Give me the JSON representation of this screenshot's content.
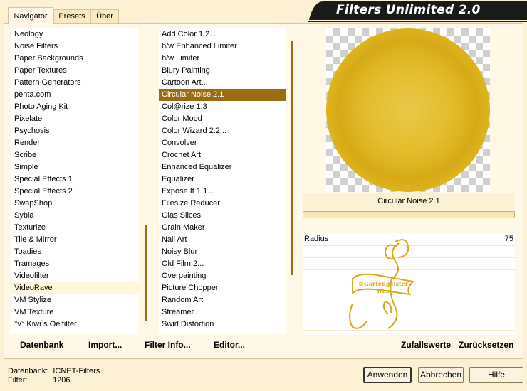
{
  "tabs": [
    {
      "label": "Navigator",
      "active": true
    },
    {
      "label": "Presets",
      "active": false
    },
    {
      "label": "Über",
      "active": false
    }
  ],
  "title": "Filters Unlimited 2.0",
  "categories": [
    "Neology",
    "Noise Filters",
    "Paper Backgrounds",
    "Paper Textures",
    "Pattern Generators",
    "penta.com",
    "Photo Aging Kit",
    "Pixelate",
    "Psychosis",
    "Render",
    "Scribe",
    "Simple",
    "Special Effects 1",
    "Special Effects 2",
    "SwapShop",
    "Sybia",
    "Texturize",
    "Tile & Mirror",
    "Toadies",
    "Tramages",
    "Videofilter",
    "VideoRave",
    "VM Stylize",
    "VM Texture",
    "°v° Kiwi`s Oelfilter"
  ],
  "selected_category": "VideoRave",
  "filters": [
    "Add Color 1.2...",
    "b/w Enhanced Limiter",
    "b/w Limiter",
    "Blury Painting",
    "Cartoon Art...",
    "Circular Noise 2.1",
    "Col@rize 1.3",
    "Color Mood",
    "Color Wizard 2.2...",
    "Convolver",
    "Crochet Art",
    "Enhanced Equalizer",
    "Equalizer",
    "Expose It 1.1...",
    "Filesize Reducer",
    "Glas Slices",
    "Grain Maker",
    "Nail Art",
    "Noisy Blur",
    "Old Film 2...",
    "Overpainting",
    "Picture Chopper",
    "Random Art",
    "Streamer...",
    "Swirl Distortion"
  ],
  "selected_filter": "Circular Noise 2.1",
  "preview_filter_name": "Circular Noise 2.1",
  "parameter": {
    "label": "Radius",
    "value": "75"
  },
  "watermark": {
    "text_line1": "©Gartengeister",
    "text_line2": "Wien",
    "color": "#d9a814"
  },
  "bottom_links": {
    "database": "Datenbank",
    "import": "Import...",
    "filter_info": "Filter Info...",
    "editor": "Editor...",
    "randomize": "Zufallswerte",
    "reset": "Zurücksetzen"
  },
  "status": {
    "database_label": "Datenbank:",
    "database_value": "ICNET-Filters",
    "filter_label": "Filter:",
    "filter_value": "1206"
  },
  "buttons": {
    "apply": "Anwenden",
    "cancel": "Abbrechen",
    "help": "Hilfe"
  },
  "colors": {
    "accent": "#9a6b10",
    "background": "#fdf1d3",
    "banner": "#1a1a1a"
  }
}
